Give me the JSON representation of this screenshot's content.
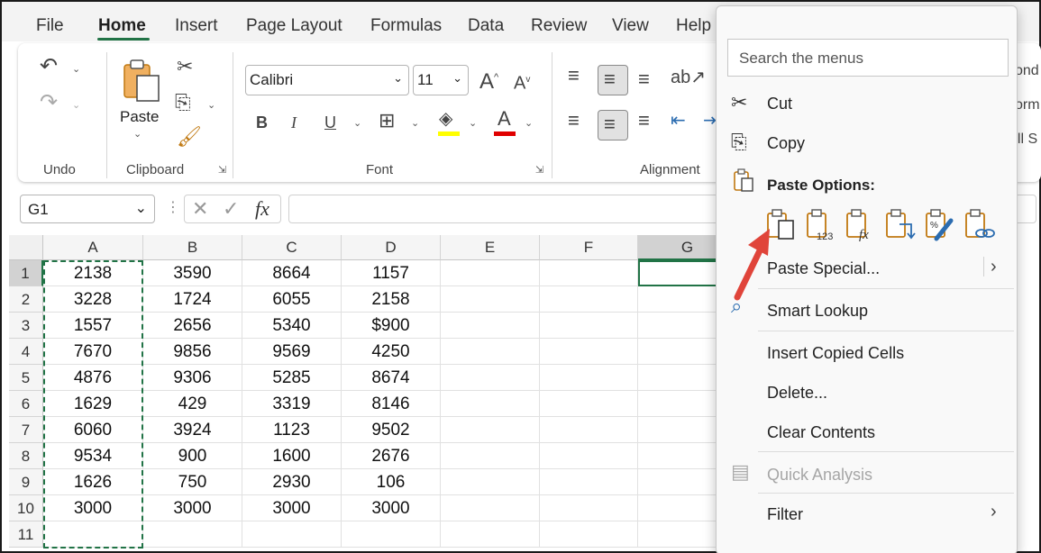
{
  "menubar": {
    "tabs": [
      "File",
      "Home",
      "Insert",
      "Page Layout",
      "Formulas",
      "Data",
      "Review",
      "View",
      "Help"
    ],
    "active_tab": "Home"
  },
  "ribbon": {
    "groups": {
      "undo": "Undo",
      "clipboard": "Clipboard",
      "font": "Font",
      "alignment": "Alignment"
    },
    "paste_label": "Paste",
    "font_name": "Calibri",
    "font_size": "11",
    "bold": "B",
    "italic": "I",
    "underline": "U",
    "grow_font": "A",
    "shrink_font": "A",
    "font_color_glyph": "A",
    "right_cutoff": [
      "ond",
      "orm",
      "ell S"
    ],
    "colors": {
      "accent": "#217346",
      "highlight": "#ffff00",
      "font_color": "#e00000"
    }
  },
  "formula_bar": {
    "name_box": "G1",
    "fx": "fx",
    "value": ""
  },
  "grid": {
    "columns": [
      "A",
      "B",
      "C",
      "D",
      "E",
      "F",
      "G"
    ],
    "rows": [
      [
        "1",
        "2138",
        "3590",
        "8664",
        "1157"
      ],
      [
        "2",
        "3228",
        "1724",
        "6055",
        "2158"
      ],
      [
        "3",
        "1557",
        "2656",
        "5340",
        "$900"
      ],
      [
        "4",
        "7670",
        "9856",
        "9569",
        "4250"
      ],
      [
        "5",
        "4876",
        "9306",
        "5285",
        "8674"
      ],
      [
        "6",
        "1629",
        "429",
        "3319",
        "8146"
      ],
      [
        "7",
        "6060",
        "3924",
        "1123",
        "9502"
      ],
      [
        "8",
        "9534",
        "900",
        "1600",
        "2676"
      ],
      [
        "9",
        "1626",
        "750",
        "2930",
        "106"
      ],
      [
        "10",
        "3000",
        "3000",
        "3000",
        "3000"
      ],
      [
        "11",
        "",
        "",
        "",
        ""
      ]
    ],
    "active_cell": "G1"
  },
  "context_menu": {
    "search_placeholder": "Search the menus",
    "cut": "Cut",
    "copy": "Copy",
    "paste_options": "Paste Options:",
    "paste_special": "Paste Special...",
    "smart_lookup": "Smart Lookup",
    "insert_copied_cells": "Insert Copied Cells",
    "delete": "Delete...",
    "clear_contents": "Clear Contents",
    "quick_analysis": "Quick Analysis",
    "filter": "Filter",
    "paste_icons": [
      "paste-icon",
      "paste-values-icon",
      "paste-formulas-icon",
      "paste-transpose-icon",
      "paste-formatting-icon",
      "paste-link-icon"
    ]
  }
}
